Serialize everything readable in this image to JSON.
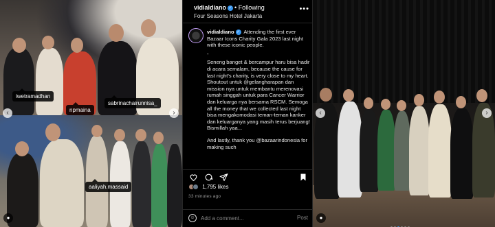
{
  "post": {
    "username": "vidialdiano",
    "separator": "•",
    "follow_label": "Following",
    "location": "Four Seasons Hotel Jakarta",
    "more_label": "•••"
  },
  "caption": {
    "username": "vidialdiano",
    "intro": "Attending the first ever Bazaar Icons Charity Gala 2023 last night with these iconic people.",
    "dash": "-",
    "body": "Seneng banget & bercampur haru bisa hadir di acara semalam, because the cause for last night's charity, is very close to my heart. Shoutout untuk @gelangharapan dan mission nya untuk membantu merenovasi rumah singgah untuk para Cancer Warrior dan keluarga nya bersama RSCM. Semoga all the money that we collected last night bisa mengakomodasi teman-teman kanker dan keluarganya yang masih terus berjuang! Bismillah yaa...",
    "outro": "And lastly, thank you @bazaarindonesia for making such"
  },
  "photo_tags": {
    "tag1": "iwetramadhan",
    "tag2": "sabrinachairunnisa_",
    "tag3": "npmaina",
    "tag4": "aaliyah.massaid"
  },
  "stats": {
    "likes": "1,795 likes",
    "time": "33 minutes ago"
  },
  "comment": {
    "placeholder": "Add a comment...",
    "post_label": "Post"
  },
  "icons": {
    "like": "heart-icon",
    "comment": "comment-icon",
    "share": "share-icon",
    "save": "bookmark-icon",
    "verified": "verified-badge-icon"
  },
  "colors": {
    "accent": "#3897f0",
    "background": "#000000"
  }
}
